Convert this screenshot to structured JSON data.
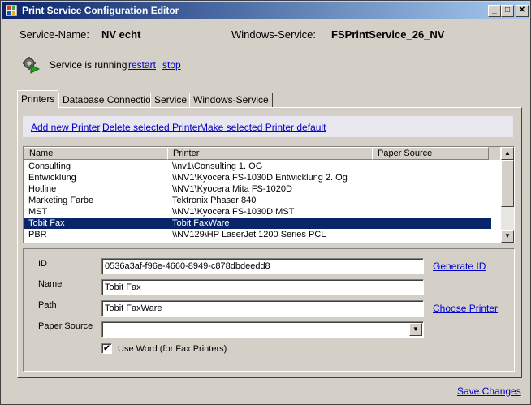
{
  "window": {
    "title": "Print Service Configuration Editor",
    "controls": {
      "minimize": "_",
      "maximize": "□",
      "close": "✕"
    }
  },
  "header": {
    "service_name_label": "Service-Name:",
    "service_name_value": "NV echt",
    "windows_service_label": "Windows-Service:",
    "windows_service_value": "FSPrintService_26_NV"
  },
  "status": {
    "icon": "gear-play-icon",
    "text": "Service is running",
    "restart": "restart",
    "stop": "stop"
  },
  "tabs": [
    {
      "label": "Printers",
      "active": true
    },
    {
      "label": "Database Connection"
    },
    {
      "label": "Service"
    },
    {
      "label": "Windows-Service"
    }
  ],
  "toolbar": {
    "add": "Add new Printer",
    "delete": "Delete selected Printer",
    "make_default": "Make selected Printer default"
  },
  "printers": {
    "columns": [
      "Name",
      "Printer",
      "Paper Source"
    ],
    "rows": [
      {
        "name": "Consulting",
        "printer": "\\\\nv1\\Consulting 1. OG",
        "source": ""
      },
      {
        "name": "Entwicklung",
        "printer": "\\\\NV1\\Kyocera FS-1030D Entwicklung 2. Og",
        "source": ""
      },
      {
        "name": "Hotline",
        "printer": "\\\\NV1\\Kyocera Mita FS-1020D",
        "source": ""
      },
      {
        "name": "Marketing Farbe",
        "printer": "Tektronix Phaser 840",
        "source": ""
      },
      {
        "name": "MST",
        "printer": "\\\\NV1\\Kyocera FS-1030D MST",
        "source": ""
      },
      {
        "name": "Tobit Fax",
        "printer": "Tobit FaxWare",
        "source": "",
        "selected": true
      },
      {
        "name": "PBR",
        "printer": "\\\\NV129\\HP LaserJet 1200 Series PCL",
        "source": ""
      }
    ]
  },
  "details": {
    "id_label": "ID",
    "id_value": "0536a3af-f96e-4660-8949-c878dbdeedd8",
    "generate_id": "Generate ID",
    "name_label": "Name",
    "name_value": "Tobit Fax",
    "path_label": "Path",
    "path_value": "Tobit FaxWare",
    "choose_printer": "Choose Printer",
    "paper_source_label": "Paper Source",
    "paper_source_value": "",
    "use_word_label": "Use Word (for Fax Printers)",
    "use_word_checked": "✔"
  },
  "footer": {
    "save": "Save Changes"
  }
}
